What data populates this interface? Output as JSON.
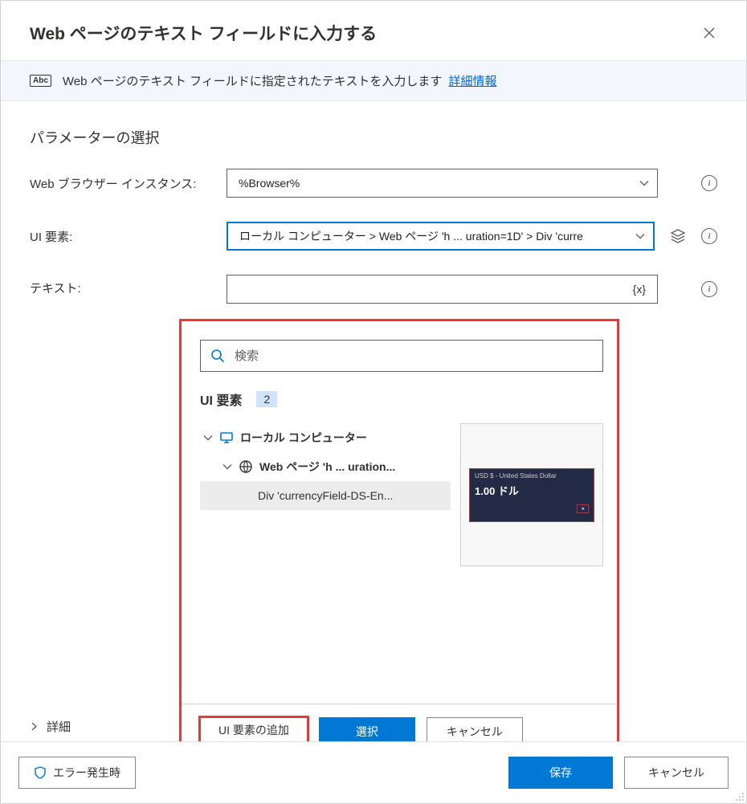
{
  "dialog": {
    "title": "Web ページのテキスト フィールドに入力する",
    "banner_text": "Web ページのテキスト フィールドに指定されたテキストを入力します",
    "banner_link": "詳細情報",
    "abc_label": "Abc"
  },
  "section": {
    "params_title": "パラメーターの選択"
  },
  "fields": {
    "browser_label": "Web ブラウザー インスタンス:",
    "browser_value": "%Browser%",
    "uielement_label": "UI 要素:",
    "uielement_value": "ローカル コンピューター  >  Web ページ 'h ... uration=1D'  >  Div 'curre",
    "text_label": "テキスト:",
    "var_symbol": "{x}"
  },
  "popup": {
    "search_placeholder": "検索",
    "header": "UI 要素",
    "count": "2",
    "tree": {
      "root": "ローカル コンピューター",
      "page": "Web ページ 'h ... uration...",
      "leaf": "Div 'currencyField-DS-En..."
    },
    "preview": {
      "topline": "USD $ - United States Dollar",
      "value": "1.00 ドル",
      "tag": "×"
    },
    "buttons": {
      "add": "UI 要素の追加",
      "select": "選択",
      "cancel": "キャンセル"
    }
  },
  "advanced_label": "詳細",
  "footer": {
    "on_error": "エラー発生時",
    "save": "保存",
    "cancel": "キャンセル"
  }
}
